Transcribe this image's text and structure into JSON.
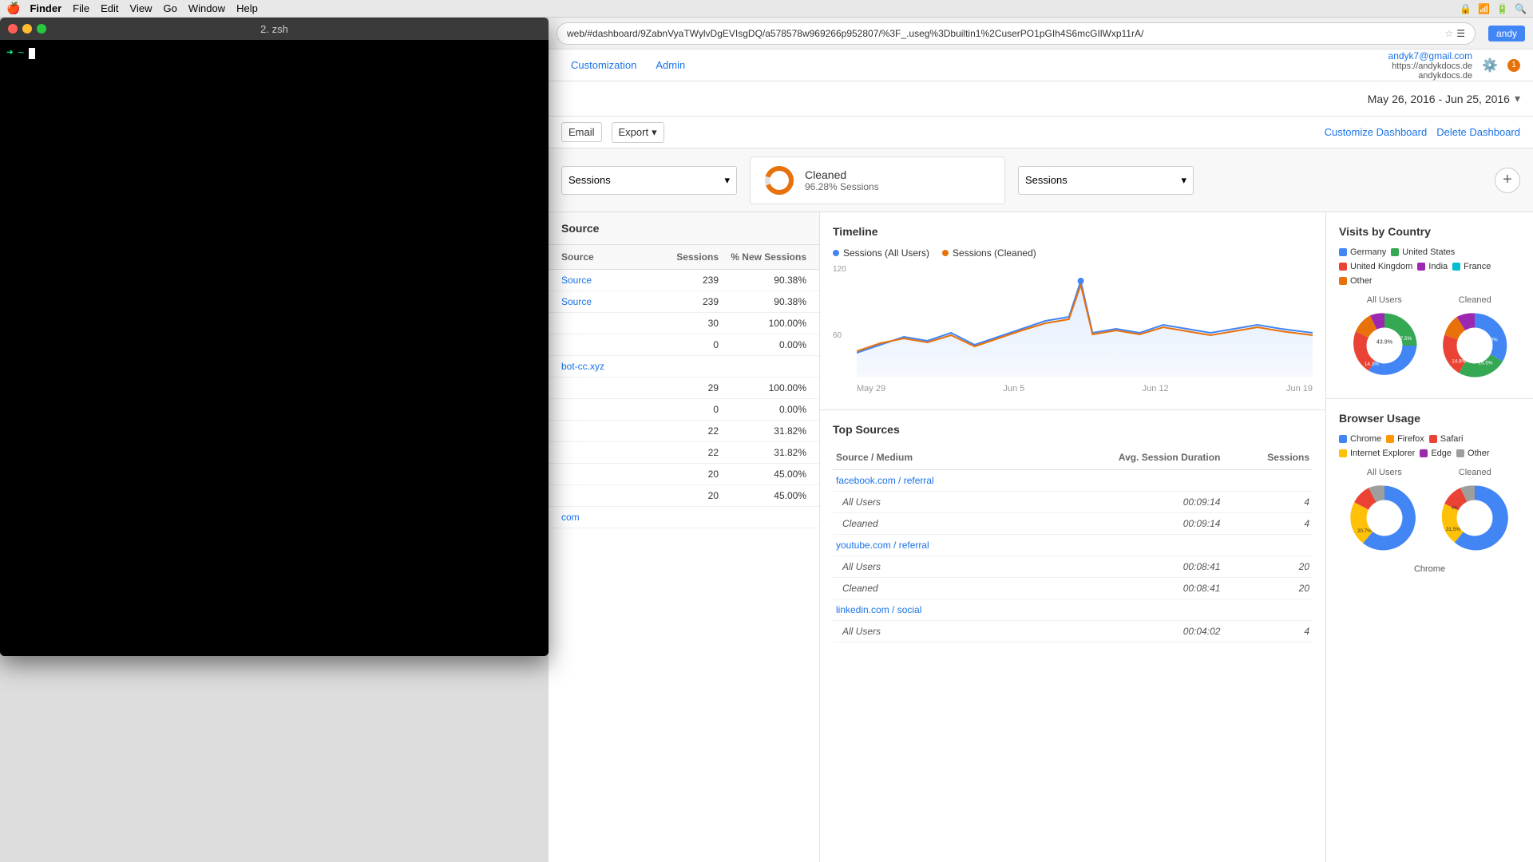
{
  "macMenubar": {
    "apple": "🍎",
    "items": [
      "Finder",
      "File",
      "Edit",
      "View",
      "Go",
      "Window",
      "Help"
    ],
    "activeItem": "Finder"
  },
  "terminal": {
    "title": "2. zsh",
    "prompt": "~",
    "arrow": "➜"
  },
  "browser": {
    "url": "web/#dashboard/9ZabnVyaTWylvDgEVIsgDQ/a578578w969266p952807/%3F_.useg%3Dbuiltin1%2CuserPO1pGIh4S6mcGIlWxp11rA/",
    "user": "andy"
  },
  "analytics": {
    "navLinks": [
      "Customization",
      "Admin"
    ],
    "userEmail": "andyk7@gmail.com",
    "userSite": "https://andykdocs.de",
    "userSite2": "andykdocs.de",
    "dateRange": "May 26, 2016 - Jun 25, 2016",
    "toolbarButtons": [
      "Email",
      "Export"
    ],
    "toolbarLinks": [
      "Customize Dashboard",
      "Delete Dashboard"
    ],
    "cleanedLabel": "Cleaned",
    "cleanedValue": "96.28% Sessions",
    "addWidget": "+",
    "tableHeaders": {
      "source": "Source",
      "sessions": "Sessions",
      "newSessions": "% New Sessions"
    },
    "tableRows": [
      {
        "source": "Source",
        "sessions": "239",
        "newSessions": "90.38%"
      },
      {
        "source": "Source",
        "sessions": "239",
        "newSessions": "90.38%"
      },
      {
        "source": "",
        "sessions": "30",
        "newSessions": "100.00%"
      },
      {
        "source": "",
        "sessions": "0",
        "newSessions": "0.00%"
      },
      {
        "source": "bot-cc.xyz",
        "sessions": "",
        "newSessions": ""
      },
      {
        "source": "",
        "sessions": "29",
        "newSessions": "100.00%"
      },
      {
        "source": "",
        "sessions": "0",
        "newSessions": "0.00%"
      },
      {
        "source": "",
        "sessions": "22",
        "newSessions": "31.82%"
      },
      {
        "source": "",
        "sessions": "22",
        "newSessions": "31.82%"
      },
      {
        "source": "",
        "sessions": "20",
        "newSessions": "45.00%"
      },
      {
        "source": "",
        "sessions": "20",
        "newSessions": "45.00%"
      },
      {
        "source": "com",
        "sessions": "",
        "newSessions": ""
      }
    ],
    "timeline": {
      "title": "Timeline",
      "legend": [
        {
          "label": "Sessions (All Users)",
          "color": "#4285f4"
        },
        {
          "label": "Sessions (Cleaned)",
          "color": "#e8710a"
        }
      ],
      "yLabel": "120",
      "yLabel2": "60",
      "xLabels": [
        "May 29",
        "Jun 5",
        "Jun 12",
        "Jun 19"
      ]
    },
    "topSources": {
      "title": "Top Sources",
      "headers": [
        "Source / Medium",
        "Avg. Session Duration",
        "Sessions"
      ],
      "rows": [
        {
          "source": "facebook.com / referral",
          "duration": "",
          "sessions": "",
          "type": "header"
        },
        {
          "source": "All Users",
          "duration": "00:09:14",
          "sessions": "4",
          "type": "sub"
        },
        {
          "source": "Cleaned",
          "duration": "00:09:14",
          "sessions": "4",
          "type": "sub"
        },
        {
          "source": "youtube.com / referral",
          "duration": "",
          "sessions": "",
          "type": "header"
        },
        {
          "source": "All Users",
          "duration": "00:08:41",
          "sessions": "20",
          "type": "sub"
        },
        {
          "source": "Cleaned",
          "duration": "00:08:41",
          "sessions": "20",
          "type": "sub"
        },
        {
          "source": "linkedin.com / social",
          "duration": "",
          "sessions": "",
          "type": "header"
        },
        {
          "source": "All Users",
          "duration": "00:04:02",
          "sessions": "4",
          "type": "sub"
        }
      ]
    },
    "visitsByCountry": {
      "title": "Visits by Country",
      "legend": [
        {
          "label": "Germany",
          "color": "#4285f4"
        },
        {
          "label": "United States",
          "color": "#34a853"
        },
        {
          "label": "United Kingdom",
          "color": "#ea4335"
        },
        {
          "label": "India",
          "color": "#9c27b0"
        },
        {
          "label": "France",
          "color": "#00bcd4"
        },
        {
          "label": "Other",
          "color": "#e8710a"
        }
      ],
      "allUsersLabel": "All Users",
      "cleanedLabel": "Cleaned",
      "allUsersPercentages": [
        {
          "label": "43.9%",
          "color": "#34a853",
          "startAngle": 0,
          "endAngle": 158
        },
        {
          "label": "27.5%",
          "color": "#4285f4",
          "startAngle": 158,
          "endAngle": 257
        },
        {
          "label": "14.3%",
          "color": "#ea4335",
          "startAngle": 257,
          "endAngle": 309
        },
        {
          "label": "",
          "color": "#e8710a",
          "startAngle": 309,
          "endAngle": 340
        },
        {
          "label": "",
          "color": "#9c27b0",
          "startAngle": 340,
          "endAngle": 360
        }
      ],
      "cleanedPercentages": [
        {
          "label": "28.6%",
          "color": "#4285f4",
          "startAngle": 0,
          "endAngle": 103
        },
        {
          "label": "26.5%",
          "color": "#34a853",
          "startAngle": 103,
          "endAngle": 198
        },
        {
          "label": "14.8%",
          "color": "#ea4335",
          "startAngle": 198,
          "endAngle": 251
        },
        {
          "label": "",
          "color": "#e8710a",
          "startAngle": 251,
          "endAngle": 290
        },
        {
          "label": "",
          "color": "#9c27b0",
          "startAngle": 290,
          "endAngle": 360
        }
      ]
    },
    "browserUsage": {
      "title": "Browser Usage",
      "legend": [
        {
          "label": "Chrome",
          "color": "#4285f4"
        },
        {
          "label": "Firefox",
          "color": "#ff9800"
        },
        {
          "label": "Safari",
          "color": "#ea4335"
        },
        {
          "label": "Internet Explorer",
          "color": "#ffc107"
        },
        {
          "label": "Edge",
          "color": "#9c27b0"
        },
        {
          "label": "Other",
          "color": "#9e9e9e"
        }
      ],
      "allUsersLabel": "All Users",
      "cleanedLabel": "Cleaned",
      "chromeLabel": "Chrome"
    }
  }
}
